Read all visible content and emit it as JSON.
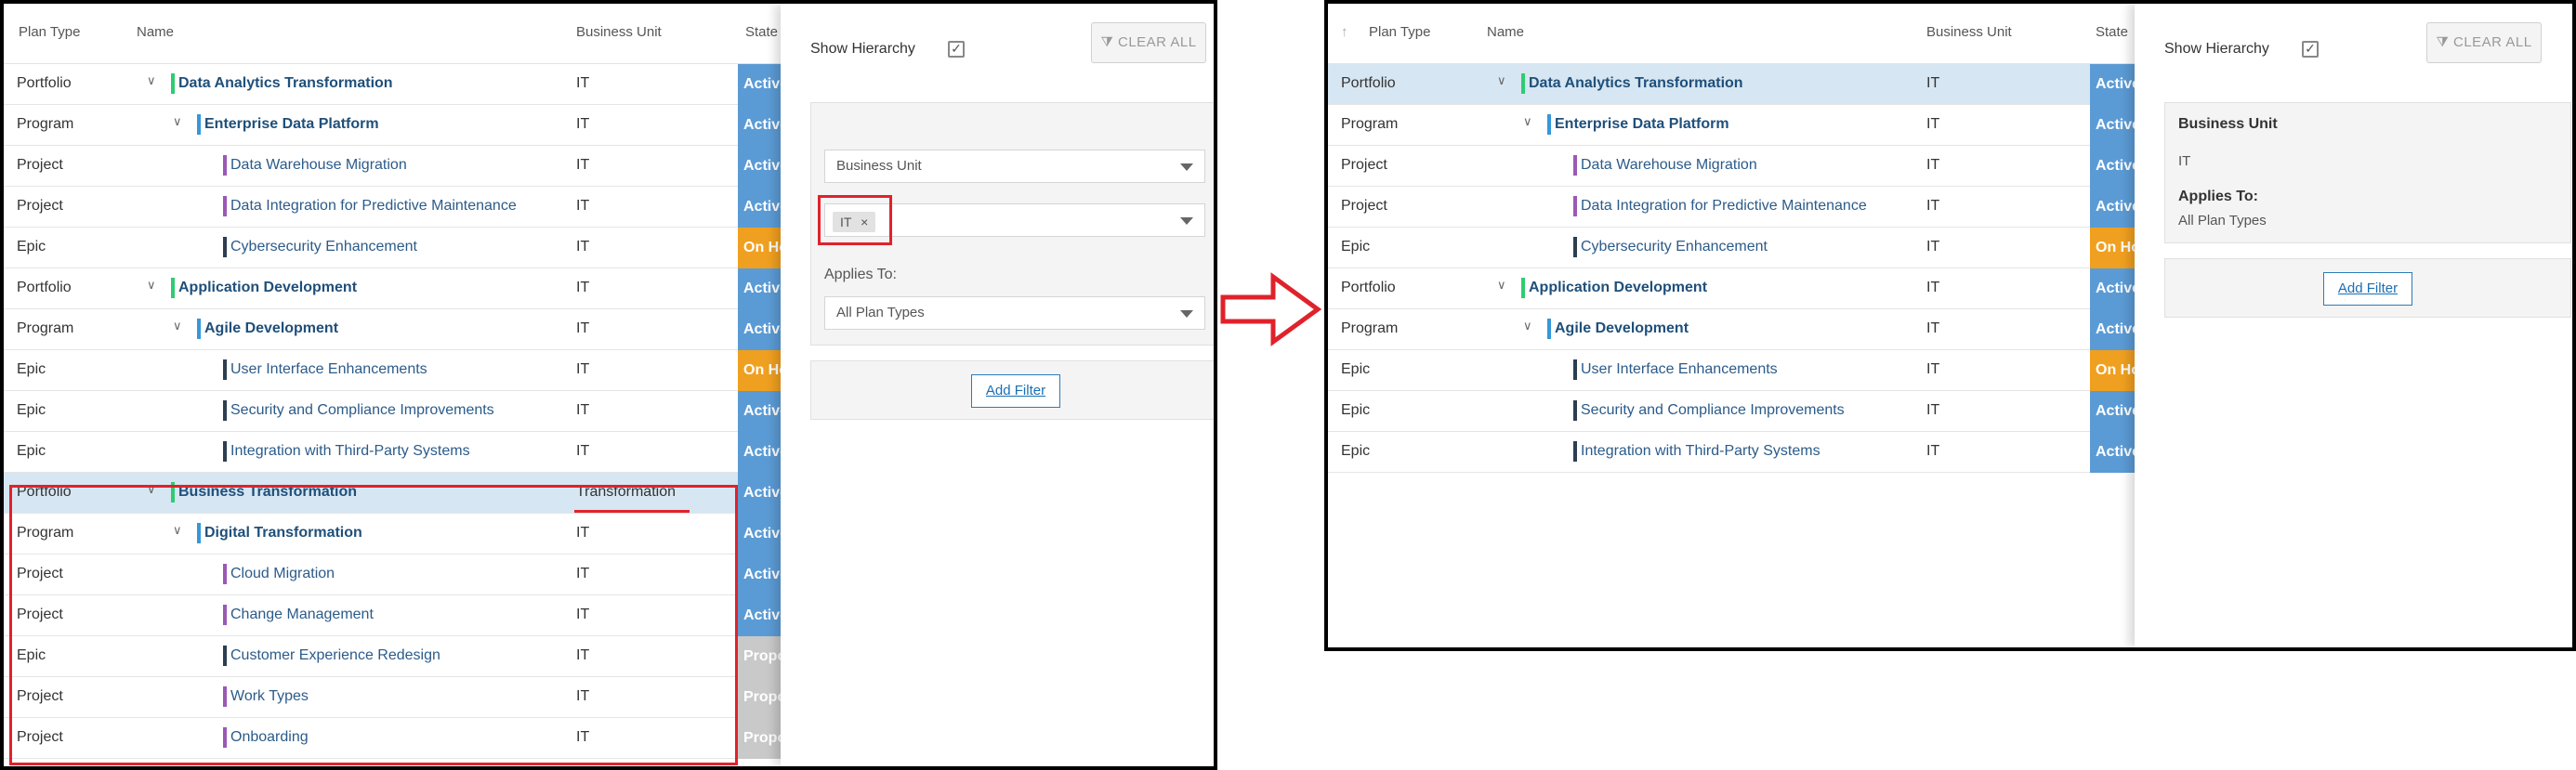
{
  "columns": {
    "plan_type": "Plan Type",
    "name": "Name",
    "business_unit": "Business Unit",
    "state": "State"
  },
  "sort_icon": "sort-up-arrow-icon",
  "state_colors": {
    "Active": "#5b9bd5",
    "On Hold": "#f0a020",
    "Proposed": "#c9c9c9"
  },
  "level_colors": {
    "Portfolio": "#2ecc71",
    "Program": "#3498db",
    "Project": "#9b59b6",
    "Epic": "#2c3e50"
  },
  "left": {
    "rows": [
      {
        "type": "Portfolio",
        "name": "Data Analytics Transformation",
        "bu": "IT",
        "state": "Active"
      },
      {
        "type": "Program",
        "name": "Enterprise Data Platform",
        "bu": "IT",
        "state": "Active"
      },
      {
        "type": "Project",
        "name": "Data Warehouse Migration",
        "bu": "IT",
        "state": "Active"
      },
      {
        "type": "Project",
        "name": "Data Integration for Predictive Maintenance",
        "bu": "IT",
        "state": "Active"
      },
      {
        "type": "Epic",
        "name": "Cybersecurity Enhancement",
        "bu": "IT",
        "state": "On Hold"
      },
      {
        "type": "Portfolio",
        "name": "Application Development",
        "bu": "IT",
        "state": "Active"
      },
      {
        "type": "Program",
        "name": "Agile Development",
        "bu": "IT",
        "state": "Active"
      },
      {
        "type": "Epic",
        "name": "User Interface Enhancements",
        "bu": "IT",
        "state": "On Hold"
      },
      {
        "type": "Epic",
        "name": "Security and Compliance Improvements",
        "bu": "IT",
        "state": "Active"
      },
      {
        "type": "Epic",
        "name": "Integration with Third-Party Systems",
        "bu": "IT",
        "state": "Active"
      },
      {
        "type": "Portfolio",
        "name": "Business Transformation",
        "bu": "Transformation",
        "state": "Active"
      },
      {
        "type": "Program",
        "name": "Digital Transformation",
        "bu": "IT",
        "state": "Active"
      },
      {
        "type": "Project",
        "name": "Cloud Migration",
        "bu": "IT",
        "state": "Active"
      },
      {
        "type": "Project",
        "name": "Change Management",
        "bu": "IT",
        "state": "Active"
      },
      {
        "type": "Epic",
        "name": "Customer Experience Redesign",
        "bu": "IT",
        "state": "Proposed"
      },
      {
        "type": "Project",
        "name": "Work Types",
        "bu": "IT",
        "state": "Proposed"
      },
      {
        "type": "Project",
        "name": "Onboarding",
        "bu": "IT",
        "state": "Proposed"
      }
    ],
    "panel": {
      "show_hierarchy": "Show Hierarchy",
      "clear_all": "CLEAR ALL",
      "field_select": "Business Unit",
      "value_tag": "IT",
      "tag_remove": "×",
      "applies_to_label": "Applies To:",
      "applies_to_value": "All Plan Types",
      "add_filter": "Add Filter"
    }
  },
  "right": {
    "rows": [
      {
        "type": "Portfolio",
        "name": "Data Analytics Transformation",
        "bu": "IT",
        "state": "Active"
      },
      {
        "type": "Program",
        "name": "Enterprise Data Platform",
        "bu": "IT",
        "state": "Active"
      },
      {
        "type": "Project",
        "name": "Data Warehouse Migration",
        "bu": "IT",
        "state": "Active"
      },
      {
        "type": "Project",
        "name": "Data Integration for Predictive Maintenance",
        "bu": "IT",
        "state": "Active"
      },
      {
        "type": "Epic",
        "name": "Cybersecurity Enhancement",
        "bu": "IT",
        "state": "On Hold"
      },
      {
        "type": "Portfolio",
        "name": "Application Development",
        "bu": "IT",
        "state": "Active"
      },
      {
        "type": "Program",
        "name": "Agile Development",
        "bu": "IT",
        "state": "Active"
      },
      {
        "type": "Epic",
        "name": "User Interface Enhancements",
        "bu": "IT",
        "state": "On Hold"
      },
      {
        "type": "Epic",
        "name": "Security and Compliance Improvements",
        "bu": "IT",
        "state": "Active"
      },
      {
        "type": "Epic",
        "name": "Integration with Third-Party Systems",
        "bu": "IT",
        "state": "Active"
      }
    ],
    "panel": {
      "show_hierarchy": "Show Hierarchy",
      "clear_all": "CLEAR ALL",
      "filter_field": "Business Unit",
      "filter_value": "IT",
      "applies_to_label": "Applies To:",
      "applies_to_value": "All Plan Types",
      "add_filter": "Add Filter"
    }
  },
  "annotation": {
    "arrow_color": "#e0222b",
    "arrow_icon": "right-arrow-icon"
  }
}
